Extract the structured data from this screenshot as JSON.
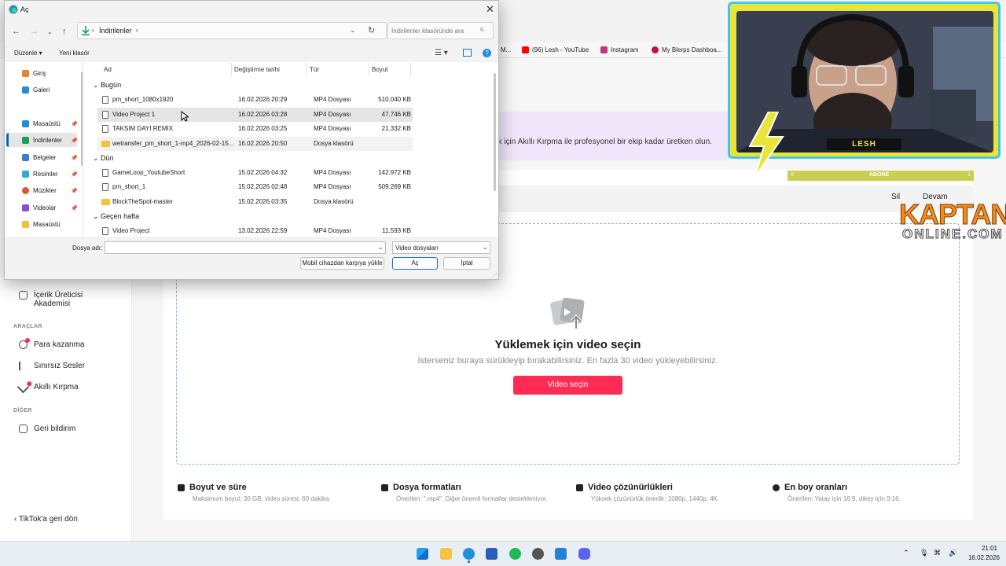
{
  "browser": {
    "bookmarks": [
      {
        "label": "M...",
        "icon": "red-icon"
      },
      {
        "label": "(96) Lesh - YouTube",
        "icon": "youtube-icon"
      },
      {
        "label": "Instagram",
        "icon": "instagram-icon"
      },
      {
        "label": "My Blerps Dashboa...",
        "icon": "blerp-icon"
      }
    ]
  },
  "tiktok": {
    "sidebar": {
      "academy": "İçerik Üreticisi Akademisi",
      "section_tools": "ARAÇLAR",
      "tools": [
        "Para kazanma",
        "Sınırsız Sesler",
        "Akıllı Kırpma"
      ],
      "section_other": "DİĞER",
      "feedback": "Geri bildirim",
      "back": "‹  TikTok'a geri dön"
    },
    "banner_text": "ok için Akıllı Kırpma ile profesyonel bir ekip kadar üretken olun.",
    "toolbar": {
      "delete": "Sil",
      "continue": "Devam"
    },
    "upload": {
      "title": "Yüklemek için video seçin",
      "subtitle": "İsterseniz buraya sürükleyip bırakabilirsiniz. En fazla 30 video yükleyebilirsiniz.",
      "button": "Video seçin"
    },
    "info": [
      {
        "title": "Boyut ve süre",
        "desc": "Maksimum boyut: 30 GB, video süresi: 60 dakika."
      },
      {
        "title": "Dosya formatları",
        "desc": "Önerilen: \".mp4\". Diğer önemli formatlar destekleniyor."
      },
      {
        "title": "Video çözünürlükleri",
        "desc": "Yüksek çözünürlük önerilir: 1080p, 1440p, 4K."
      },
      {
        "title": "En boy oranları",
        "desc": "Önerilen: Yatay için 16:9, dikey için 9:16."
      }
    ]
  },
  "overlay": {
    "name": "LESH",
    "sub_left": "0",
    "sub_center": "ABONE",
    "sub_right": "1",
    "brand_top": "KAPTAN",
    "brand_bottom": "ONLINE.COM"
  },
  "dialog": {
    "title": "Aç",
    "path": "İndirilenler",
    "search_placeholder": "İndirilenler klasöründe ara",
    "cmd_organize": "Düzenle ▾",
    "cmd_new_folder": "Yeni klasör",
    "nav": [
      {
        "label": "Giriş",
        "icon": "home-icon"
      },
      {
        "label": "Galeri",
        "icon": "gallery-icon"
      },
      {
        "label": "Masaüstü",
        "icon": "desktop-icon"
      },
      {
        "label": "İndirilenler",
        "icon": "downloads-icon"
      },
      {
        "label": "Belgeler",
        "icon": "documents-icon"
      },
      {
        "label": "Resimler",
        "icon": "pictures-icon"
      },
      {
        "label": "Müzikler",
        "icon": "music-icon"
      },
      {
        "label": "Videolar",
        "icon": "videos-icon"
      },
      {
        "label": "Masaüstü",
        "icon": "folder-icon"
      }
    ],
    "columns": [
      "Ad",
      "Değiştirme tarihi",
      "Tür",
      "Boyut"
    ],
    "groups": [
      "Bugün",
      "Dün",
      "Geçen hafta"
    ],
    "rows": [
      {
        "name": "pm_short_1080x1920",
        "date": "16.02.2026 20:29",
        "type": "MP4 Dosyası",
        "size": "510.040 KB"
      },
      {
        "name": "Video Project 1",
        "date": "16.02.2026 03:28",
        "type": "MP4 Dosyası",
        "size": "47.746 KB"
      },
      {
        "name": "TAKSIM DAYI REMIX",
        "date": "16.02.2026 03:25",
        "type": "MP4 Dosyası",
        "size": "21.332 KB"
      },
      {
        "name": "wetransfer_pm_short_1-mp4_2026-02-15...",
        "date": "16.02.2026 20:50",
        "type": "Dosya klasörü",
        "size": ""
      },
      {
        "name": "GameLoop_YoutubeShort",
        "date": "15.02.2026 04:32",
        "type": "MP4 Dosyası",
        "size": "142.972 KB"
      },
      {
        "name": "pm_short_1",
        "date": "15.02.2026 02:48",
        "type": "MP4 Dosyası",
        "size": "509.269 KB"
      },
      {
        "name": "BlockTheSpot-master",
        "date": "15.02.2026 03:35",
        "type": "Dosya klasörü",
        "size": ""
      },
      {
        "name": "Video Project",
        "date": "13.02.2026 22:59",
        "type": "MP4 Dosyası",
        "size": "11.593 KB"
      }
    ],
    "filename_label": "Dosya adı:",
    "filetype": "Video dosyaları",
    "btn_mobile": "Mobil cihazdan karşıya yükle",
    "btn_open": "Aç",
    "btn_cancel": "İptal"
  },
  "taskbar": {
    "time": "21:01",
    "date": "16.02.2026"
  }
}
